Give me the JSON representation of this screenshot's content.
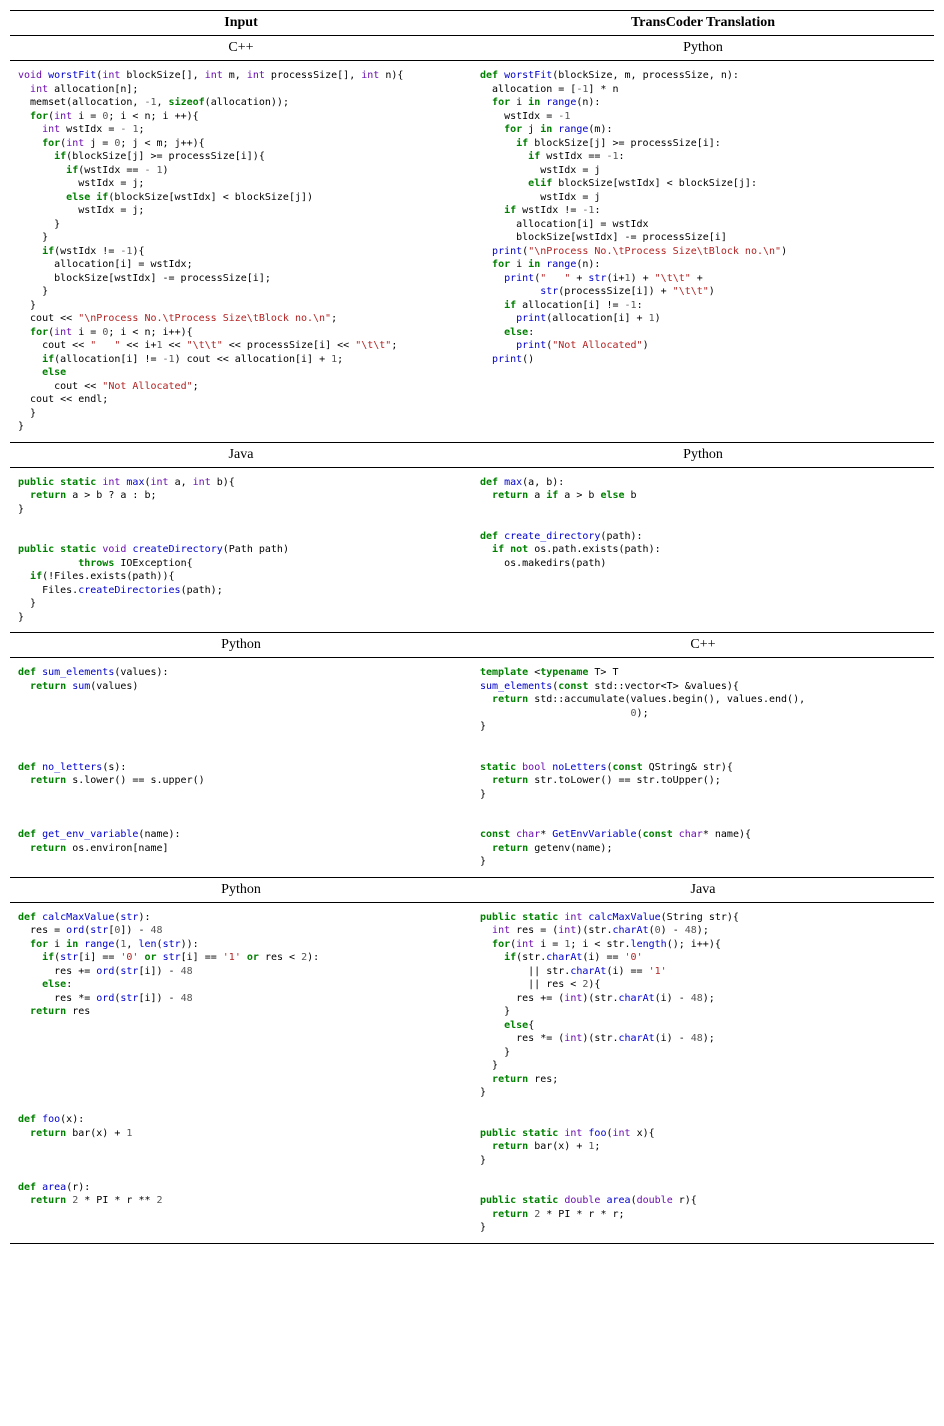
{
  "top_headers": {
    "left": "Input",
    "right": "TransCoder Translation"
  },
  "sections": [
    {
      "left_lang": "C++",
      "right_lang": "Python",
      "left_code_html": "<span class=\"ty\">void</span> <span class=\"fn\">worstFit</span>(<span class=\"ty\">int</span> blockSize[], <span class=\"ty\">int</span> m, <span class=\"ty\">int</span> processSize[], <span class=\"ty\">int</span> n){\n  <span class=\"ty\">int</span> allocation[n];\n  memset(allocation, <span class=\"op\">-</span><span class=\"nm\">1</span>, <span class=\"kw\">sizeof</span>(allocation));\n  <span class=\"kw\">for</span>(<span class=\"ty\">int</span> i = <span class=\"nm\">0</span>; i &lt; n; i ++){\n    <span class=\"ty\">int</span> wstIdx = <span class=\"op\">-</span> <span class=\"nm\">1</span>;\n    <span class=\"kw\">for</span>(<span class=\"ty\">int</span> j = <span class=\"nm\">0</span>; j &lt; m; j++){\n      <span class=\"kw\">if</span>(blockSize[j] &gt;= processSize[i]){\n        <span class=\"kw\">if</span>(wstIdx == <span class=\"op\">-</span> <span class=\"nm\">1</span>)\n          wstIdx = j;\n        <span class=\"kw\">else if</span>(blockSize[wstIdx] &lt; blockSize[j])\n          wstIdx = j;\n      }\n    }\n    <span class=\"kw\">if</span>(wstIdx != <span class=\"op\">-</span><span class=\"nm\">1</span>){\n      allocation[i] = wstIdx;\n      blockSize[wstIdx] -= processSize[i];\n    }\n  }\n  cout &lt;&lt; <span class=\"st\">\"\\nProcess No.\\tProcess Size\\tBlock no.\\n\"</span>;\n  <span class=\"kw\">for</span>(<span class=\"ty\">int</span> i = <span class=\"nm\">0</span>; i &lt; n; i++){\n    cout &lt;&lt; <span class=\"st\">\"   \"</span> &lt;&lt; i+<span class=\"nm\">1</span> &lt;&lt; <span class=\"st\">\"\\t\\t\"</span> &lt;&lt; processSize[i] &lt;&lt; <span class=\"st\">\"\\t\\t\"</span>;\n    <span class=\"kw\">if</span>(allocation[i] != <span class=\"op\">-</span><span class=\"nm\">1</span>) cout &lt;&lt; allocation[i] + <span class=\"nm\">1</span>;\n    <span class=\"kw\">else</span>\n      cout &lt;&lt; <span class=\"st\">\"Not Allocated\"</span>;\n  cout &lt;&lt; endl;\n  }\n}",
      "right_code_html": "<span class=\"kw\">def</span> <span class=\"fn\">worstFit</span>(blockSize, m, processSize, n):\n  allocation = [<span class=\"op\">-</span><span class=\"nm\">1</span>] * n\n  <span class=\"kw\">for</span> i <span class=\"kw\">in</span> <span class=\"fn\">range</span>(n):\n    wstIdx = <span class=\"op\">-</span><span class=\"nm\">1</span>\n    <span class=\"kw\">for</span> j <span class=\"kw\">in</span> <span class=\"fn\">range</span>(m):\n      <span class=\"kw\">if</span> blockSize[j] &gt;= processSize[i]:\n        <span class=\"kw\">if</span> wstIdx == <span class=\"op\">-</span><span class=\"nm\">1</span>:\n          wstIdx = j\n        <span class=\"kw\">elif</span> blockSize[wstIdx] &lt; blockSize[j]:\n          wstIdx = j\n    <span class=\"kw\">if</span> wstIdx != <span class=\"op\">-</span><span class=\"nm\">1</span>:\n      allocation[i] = wstIdx\n      blockSize[wstIdx] -= processSize[i]\n  <span class=\"fn\">print</span>(<span class=\"st\">\"\\nProcess No.\\tProcess Size\\tBlock no.\\n\"</span>)\n  <span class=\"kw\">for</span> i <span class=\"kw\">in</span> <span class=\"fn\">range</span>(n):\n    <span class=\"fn\">print</span>(<span class=\"st\">\"   \"</span> + <span class=\"fn\">str</span>(i+<span class=\"nm\">1</span>) + <span class=\"st\">\"\\t\\t\"</span> +\n          <span class=\"fn\">str</span>(processSize[i]) + <span class=\"st\">\"\\t\\t\"</span>)\n    <span class=\"kw\">if</span> allocation[i] != <span class=\"op\">-</span><span class=\"nm\">1</span>:\n      <span class=\"fn\">print</span>(allocation[i] + <span class=\"nm\">1</span>)\n    <span class=\"kw\">else</span>:\n      <span class=\"fn\">print</span>(<span class=\"st\">\"Not Allocated\"</span>)\n  <span class=\"fn\">print</span>()"
    },
    {
      "left_lang": "Java",
      "right_lang": "Python",
      "left_code_html": "<span class=\"kw\">public static</span> <span class=\"ty\">int</span> <span class=\"fn\">max</span>(<span class=\"ty\">int</span> a, <span class=\"ty\">int</span> b){\n  <span class=\"kw\">return</span> a &gt; b ? a : b;\n}\n\n\n<span class=\"kw\">public static</span> <span class=\"ty\">void</span> <span class=\"fn\">createDirectory</span>(Path path)\n          <span class=\"kw\">throws</span> IOException{\n  <span class=\"kw\">if</span>(!Files.exists(path)){\n    Files.<span class=\"fn\">createDirectories</span>(path);\n  }\n}",
      "right_code_html": "<span class=\"kw\">def</span> <span class=\"fn\">max</span>(a, b):\n  <span class=\"kw\">return</span> a <span class=\"kw\">if</span> a &gt; b <span class=\"kw\">else</span> b\n\n\n<span class=\"kw\">def</span> <span class=\"fn\">create_directory</span>(path):\n  <span class=\"kw\">if not</span> os.path.exists(path):\n    os.makedirs(path)"
    },
    {
      "left_lang": "Python",
      "right_lang": "C++",
      "left_code_html": "<span class=\"kw\">def</span> <span class=\"fn\">sum_elements</span>(values):\n  <span class=\"kw\">return</span> <span class=\"fn\">sum</span>(values)\n\n\n\n\n\n<span class=\"kw\">def</span> <span class=\"fn\">no_letters</span>(s):\n  <span class=\"kw\">return</span> s.lower() == s.upper()\n\n\n\n<span class=\"kw\">def</span> <span class=\"fn\">get_env_variable</span>(name):\n  <span class=\"kw\">return</span> os.environ[name]",
      "right_code_html": "<span class=\"kw\">template</span> &lt;<span class=\"kw\">typename</span> T&gt; T\n<span class=\"fn\">sum_elements</span>(<span class=\"kw\">const</span> std::vector&lt;T&gt; &amp;values){\n  <span class=\"kw\">return</span> std::accumulate(values.begin(), values.end(),\n                         <span class=\"nm\">0</span>);\n}\n\n\n<span class=\"kw\">static</span> <span class=\"ty\">bool</span> <span class=\"fn\">noLetters</span>(<span class=\"kw\">const</span> QString&amp; str){\n  <span class=\"kw\">return</span> str.toLower() == str.toUpper();\n}\n\n\n<span class=\"kw\">const</span> <span class=\"ty\">char</span>* <span class=\"fn\">GetEnvVariable</span>(<span class=\"kw\">const</span> <span class=\"ty\">char</span>* name){\n  <span class=\"kw\">return</span> getenv(name);\n}"
    },
    {
      "left_lang": "Python",
      "right_lang": "Java",
      "left_code_html": "<span class=\"kw\">def</span> <span class=\"fn\">calcMaxValue</span>(<span class=\"fn\">str</span>):\n  res = <span class=\"fn\">ord</span>(<span class=\"fn\">str</span>[<span class=\"nm\">0</span>]) - <span class=\"nm\">48</span>\n  <span class=\"kw\">for</span> i <span class=\"kw\">in</span> <span class=\"fn\">range</span>(<span class=\"nm\">1</span>, <span class=\"fn\">len</span>(<span class=\"fn\">str</span>)):\n    <span class=\"kw\">if</span>(<span class=\"fn\">str</span>[i] == <span class=\"st\">'0'</span> <span class=\"kw\">or</span> <span class=\"fn\">str</span>[i] == <span class=\"st\">'1'</span> <span class=\"kw\">or</span> res &lt; <span class=\"nm\">2</span>):\n      res += <span class=\"fn\">ord</span>(<span class=\"fn\">str</span>[i]) - <span class=\"nm\">48</span>\n    <span class=\"kw\">else</span>:\n      res *= <span class=\"fn\">ord</span>(<span class=\"fn\">str</span>[i]) - <span class=\"nm\">48</span>\n  <span class=\"kw\">return</span> res\n\n\n\n\n\n\n\n<span class=\"kw\">def</span> <span class=\"fn\">foo</span>(x):\n  <span class=\"kw\">return</span> bar(x) + <span class=\"nm\">1</span>\n\n\n\n<span class=\"kw\">def</span> <span class=\"fn\">area</span>(r):\n  <span class=\"kw\">return</span> <span class=\"nm\">2</span> * PI * r ** <span class=\"nm\">2</span>",
      "right_code_html": "<span class=\"kw\">public static</span> <span class=\"ty\">int</span> <span class=\"fn\">calcMaxValue</span>(String str){\n  <span class=\"ty\">int</span> res = (<span class=\"ty\">int</span>)(str.<span class=\"fn\">charAt</span>(<span class=\"nm\">0</span>) - <span class=\"nm\">48</span>);\n  <span class=\"kw\">for</span>(<span class=\"ty\">int</span> i = <span class=\"nm\">1</span>; i &lt; str.<span class=\"fn\">length</span>(); i++){\n    <span class=\"kw\">if</span>(str.<span class=\"fn\">charAt</span>(i) == <span class=\"st\">'0'</span>\n        || str.<span class=\"fn\">charAt</span>(i) == <span class=\"st\">'1'</span>\n        || res &lt; <span class=\"nm\">2</span>){\n      res += (<span class=\"ty\">int</span>)(str.<span class=\"fn\">charAt</span>(i) - <span class=\"nm\">48</span>);\n    }\n    <span class=\"kw\">else</span>{\n      res *= (<span class=\"ty\">int</span>)(str.<span class=\"fn\">charAt</span>(i) - <span class=\"nm\">48</span>);\n    }\n  }\n  <span class=\"kw\">return</span> res;\n}\n\n\n<span class=\"kw\">public static</span> <span class=\"ty\">int</span> <span class=\"fn\">foo</span>(<span class=\"ty\">int</span> x){\n  <span class=\"kw\">return</span> bar(x) + <span class=\"nm\">1</span>;\n}\n\n\n<span class=\"kw\">public static</span> <span class=\"ty\">double</span> <span class=\"fn\">area</span>(<span class=\"ty\">double</span> r){\n  <span class=\"kw\">return</span> <span class=\"nm\">2</span> * PI * r * r;\n}"
    }
  ]
}
